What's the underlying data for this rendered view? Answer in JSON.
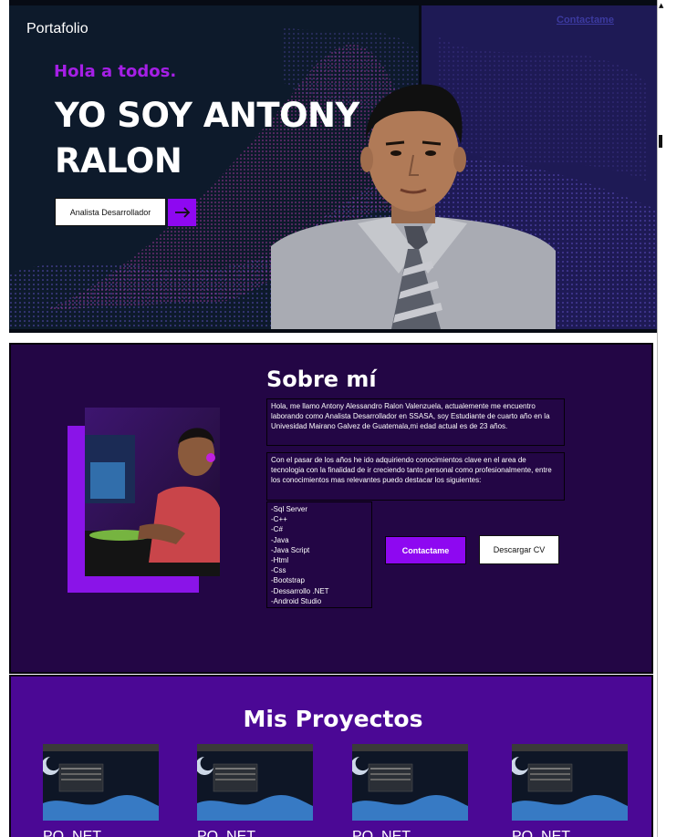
{
  "nav": {
    "brand": "Portafolio",
    "contact_link": "Contactame"
  },
  "hero": {
    "greeting": "Hola a todos.",
    "name_line1": "YO SOY ANTONY",
    "name_line2": "RALON",
    "role_button": "Analista Desarrollador",
    "arrow_icon": "arrow-right-icon",
    "accent_color": "#8e08f1",
    "greeting_color": "#a51fe6"
  },
  "about": {
    "title": "Sobre mí",
    "paragraph1": "Hola, me llamo Antony Alessandro Ralon Valenzuela, actualemente me encuentro laborando como Analista Desarrollador en SSASA, soy Estudiante de cuarto año en la Univesidad Mairano Galvez de Guatemala,mi edad actual es de 23 años.",
    "paragraph2": "Con el pasar de los años he ido adquiriendo conocimientos clave en el area de tecnologia con la finalidad de ir creciendo tanto personal como profesionalmente, entre los conocimientos mas relevantes puedo destacar los siguientes:",
    "skills": [
      "-Sql Server",
      "-C++",
      "-C#",
      "-Java",
      "-Java Script",
      "-Html",
      "-Css",
      "-Bootstrap",
      "-Dessarrollo .NET",
      "-Android Studio"
    ],
    "contact_button": "Contactame",
    "cv_button": "Descargar CV"
  },
  "projects": {
    "title": "Mis Proyectos",
    "items": [
      {
        "label": "PO .NET"
      },
      {
        "label": "PO .NET"
      },
      {
        "label": "PO .NET"
      },
      {
        "label": "PO .NET"
      }
    ]
  }
}
